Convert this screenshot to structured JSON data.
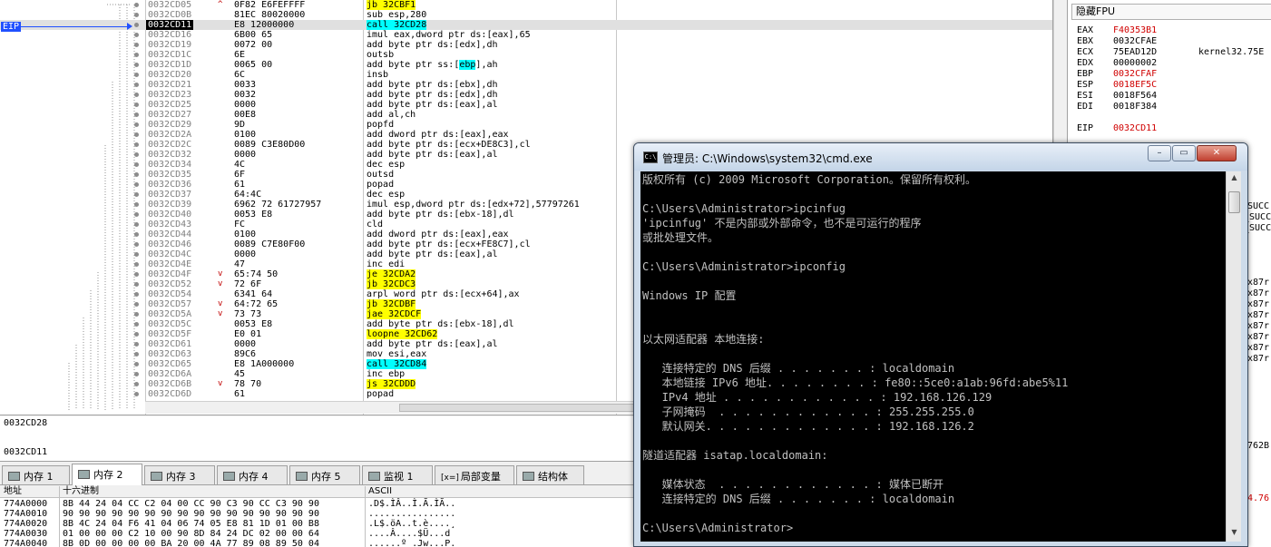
{
  "disasm": {
    "eip_label": "EIP",
    "rows": [
      {
        "addr": "0032CD05",
        "mark": "^",
        "hex": "0F82 E6FEFFFF",
        "asm": [
          {
            "t": "jb 32CBF1",
            "h": "y"
          }
        ]
      },
      {
        "addr": "0032CD0B",
        "mark": "",
        "hex": "81EC 80020000",
        "asm": [
          {
            "t": "sub esp,280"
          }
        ]
      },
      {
        "addr": "0032CD11",
        "mark": "",
        "hex": "E8 12000000",
        "asm": [
          {
            "t": "call 32CD28",
            "h": "c"
          }
        ],
        "current": true
      },
      {
        "addr": "0032CD16",
        "mark": "",
        "hex": "6B00 65",
        "asm": [
          {
            "t": "imul eax,dword ptr ds:[eax],65"
          }
        ]
      },
      {
        "addr": "0032CD19",
        "mark": "",
        "hex": "0072 00",
        "asm": [
          {
            "t": "add byte ptr ds:[edx],dh"
          }
        ]
      },
      {
        "addr": "0032CD1C",
        "mark": "",
        "hex": "6E",
        "asm": [
          {
            "t": "outsb"
          }
        ]
      },
      {
        "addr": "0032CD1D",
        "mark": "",
        "hex": "0065 00",
        "asm": [
          {
            "t": "add byte ptr ss:["
          },
          {
            "t": "ebp",
            "h": "c"
          },
          {
            "t": "],ah"
          }
        ]
      },
      {
        "addr": "0032CD20",
        "mark": "",
        "hex": "6C",
        "asm": [
          {
            "t": "insb"
          }
        ]
      },
      {
        "addr": "0032CD21",
        "mark": "",
        "hex": "0033",
        "asm": [
          {
            "t": "add byte ptr ds:[ebx],dh"
          }
        ]
      },
      {
        "addr": "0032CD23",
        "mark": "",
        "hex": "0032",
        "asm": [
          {
            "t": "add byte ptr ds:[edx],dh"
          }
        ]
      },
      {
        "addr": "0032CD25",
        "mark": "",
        "hex": "0000",
        "asm": [
          {
            "t": "add byte ptr ds:[eax],al"
          }
        ]
      },
      {
        "addr": "0032CD27",
        "mark": "",
        "hex": "00E8",
        "asm": [
          {
            "t": "add al,ch"
          }
        ]
      },
      {
        "addr": "0032CD29",
        "mark": "",
        "hex": "9D",
        "asm": [
          {
            "t": "popfd"
          }
        ]
      },
      {
        "addr": "0032CD2A",
        "mark": "",
        "hex": "0100",
        "asm": [
          {
            "t": "add dword ptr ds:[eax],eax"
          }
        ]
      },
      {
        "addr": "0032CD2C",
        "mark": "",
        "hex": "0089 C3E80D00",
        "asm": [
          {
            "t": "add byte ptr ds:[ecx+DE8C3],cl"
          }
        ]
      },
      {
        "addr": "0032CD32",
        "mark": "",
        "hex": "0000",
        "asm": [
          {
            "t": "add byte ptr ds:[eax],al"
          }
        ]
      },
      {
        "addr": "0032CD34",
        "mark": "",
        "hex": "4C",
        "asm": [
          {
            "t": "dec esp"
          }
        ]
      },
      {
        "addr": "0032CD35",
        "mark": "",
        "hex": "6F",
        "asm": [
          {
            "t": "outsd"
          }
        ]
      },
      {
        "addr": "0032CD36",
        "mark": "",
        "hex": "61",
        "asm": [
          {
            "t": "popad"
          }
        ]
      },
      {
        "addr": "0032CD37",
        "mark": "",
        "hex": "64:4C",
        "asm": [
          {
            "t": "dec esp"
          }
        ]
      },
      {
        "addr": "0032CD39",
        "mark": "",
        "hex": "6962 72 61727957",
        "asm": [
          {
            "t": "imul esp,dword ptr ds:[edx+72],57797261"
          }
        ]
      },
      {
        "addr": "0032CD40",
        "mark": "",
        "hex": "0053 E8",
        "asm": [
          {
            "t": "add byte ptr ds:[ebx-18],dl"
          }
        ]
      },
      {
        "addr": "0032CD43",
        "mark": "",
        "hex": "FC",
        "asm": [
          {
            "t": "cld"
          }
        ]
      },
      {
        "addr": "0032CD44",
        "mark": "",
        "hex": "0100",
        "asm": [
          {
            "t": "add dword ptr ds:[eax],eax"
          }
        ]
      },
      {
        "addr": "0032CD46",
        "mark": "",
        "hex": "0089 C7E80F00",
        "asm": [
          {
            "t": "add byte ptr ds:[ecx+FE8C7],cl"
          }
        ]
      },
      {
        "addr": "0032CD4C",
        "mark": "",
        "hex": "0000",
        "asm": [
          {
            "t": "add byte ptr ds:[eax],al"
          }
        ]
      },
      {
        "addr": "0032CD4E",
        "mark": "",
        "hex": "47",
        "asm": [
          {
            "t": "inc edi"
          }
        ]
      },
      {
        "addr": "0032CD4F",
        "mark": "v",
        "hex": "65:74 50",
        "asm": [
          {
            "t": "je 32CDA2",
            "h": "y"
          }
        ]
      },
      {
        "addr": "0032CD52",
        "mark": "v",
        "hex": "72 6F",
        "asm": [
          {
            "t": "jb 32CDC3",
            "h": "y"
          }
        ]
      },
      {
        "addr": "0032CD54",
        "mark": "",
        "hex": "6341 64",
        "asm": [
          {
            "t": "arpl word ptr ds:[ecx+64],ax"
          }
        ]
      },
      {
        "addr": "0032CD57",
        "mark": "v",
        "hex": "64:72 65",
        "asm": [
          {
            "t": "jb 32CDBF",
            "h": "y"
          }
        ]
      },
      {
        "addr": "0032CD5A",
        "mark": "v",
        "hex": "73 73",
        "asm": [
          {
            "t": "jae 32CDCF",
            "h": "y"
          }
        ]
      },
      {
        "addr": "0032CD5C",
        "mark": "",
        "hex": "0053 E8",
        "asm": [
          {
            "t": "add byte ptr ds:[ebx-18],dl"
          }
        ]
      },
      {
        "addr": "0032CD5F",
        "mark": "",
        "hex": "E0 01",
        "asm": [
          {
            "t": "loopne 32CD62",
            "h": "y"
          }
        ]
      },
      {
        "addr": "0032CD61",
        "mark": "",
        "hex": "0000",
        "asm": [
          {
            "t": "add byte ptr ds:[eax],al"
          }
        ]
      },
      {
        "addr": "0032CD63",
        "mark": "",
        "hex": "89C6",
        "asm": [
          {
            "t": "mov esi,eax"
          }
        ]
      },
      {
        "addr": "0032CD65",
        "mark": "",
        "hex": "E8 1A000000",
        "asm": [
          {
            "t": "call 32CD84",
            "h": "c"
          }
        ]
      },
      {
        "addr": "0032CD6A",
        "mark": "",
        "hex": "45",
        "asm": [
          {
            "t": "inc ebp"
          }
        ]
      },
      {
        "addr": "0032CD6B",
        "mark": "v",
        "hex": "78 70",
        "asm": [
          {
            "t": "js 32CDDD",
            "h": "y"
          }
        ]
      },
      {
        "addr": "0032CD6D",
        "mark": "",
        "hex": "61",
        "asm": [
          {
            "t": "popad"
          }
        ]
      }
    ]
  },
  "info": {
    "line1": "0032CD28",
    "line2": "0032CD11"
  },
  "tabs": [
    {
      "label": "内存 1",
      "active": false
    },
    {
      "label": "内存 2",
      "active": true
    },
    {
      "label": "内存 3",
      "active": false
    },
    {
      "label": "内存 4",
      "active": false
    },
    {
      "label": "内存 5",
      "active": false
    },
    {
      "label": "监视 1",
      "active": false
    },
    {
      "label": "局部变量",
      "prefix": "[x=]",
      "active": false
    },
    {
      "label": "结构体",
      "active": false
    }
  ],
  "dump": {
    "col_addr": "地址",
    "col_hex": "十六进制",
    "col_ascii": "ASCII",
    "rows": [
      {
        "addr": "774A0000",
        "hex": "8B 44 24 04 CC C2 04 00 CC 90 C3 90 CC C3 90 90",
        "ascii": ".D$.ÌÂ..Ì.Ã.ÌÃ.."
      },
      {
        "addr": "774A0010",
        "hex": "90 90 90 90 90 90 90 90 90 90 90 90 90 90 90 90",
        "ascii": "................"
      },
      {
        "addr": "774A0020",
        "hex": "8B 4C 24 04 F6 41 04 06 74 05 E8 81 1D 01 00 B8",
        "ascii": ".L$.öA..t.è....¸"
      },
      {
        "addr": "774A0030",
        "hex": "01 00 00 00 C2 10 00 90 8D 84 24 DC 02 00 00 64",
        "ascii": "....Â....$Ü...d"
      },
      {
        "addr": "774A0040",
        "hex": "8B 0D 00 00 00 00 BA 20 00 4A 77 89 08 89 50 04",
        "ascii": "......º .Jw...P."
      }
    ]
  },
  "registers": {
    "title": "隐藏FPU",
    "items": [
      {
        "name": "EAX",
        "value": "F40353B1",
        "red": true,
        "extra": ""
      },
      {
        "name": "EBX",
        "value": "0032CFAE",
        "red": false,
        "extra": ""
      },
      {
        "name": "ECX",
        "value": "75EAD12D",
        "red": false,
        "extra": "kernel32.75E"
      },
      {
        "name": "EDX",
        "value": "00000002",
        "red": false,
        "extra": ""
      },
      {
        "name": "EBP",
        "value": "0032CFAF",
        "red": true,
        "extra": ""
      },
      {
        "name": "ESP",
        "value": "0018EF5C",
        "red": true,
        "extra": ""
      },
      {
        "name": "ESI",
        "value": "0018F564",
        "red": false,
        "extra": ""
      },
      {
        "name": "EDI",
        "value": "0018F384",
        "red": false,
        "extra": ""
      }
    ],
    "eip": {
      "name": "EIP",
      "value": "0032CD11"
    },
    "side_fragments": [
      "SUCC",
      "_SUCC",
      "_SUCC",
      "x87r",
      "x87r",
      "x87r",
      "x87r",
      "x87r",
      "x87r",
      "x87r",
      "x87r",
      "762B",
      "4.76"
    ]
  },
  "cmd": {
    "title": "管理员: C:\\Windows\\system32\\cmd.exe",
    "icon_text": "C:\\",
    "buttons": {
      "minimize": "–",
      "restore": "▭",
      "close": "✕"
    },
    "lines": [
      "版权所有 (c) 2009 Microsoft Corporation。保留所有权利。",
      "",
      "C:\\Users\\Administrator>ipcinfug",
      "'ipcinfug' 不是内部或外部命令，也不是可运行的程序",
      "或批处理文件。",
      "",
      "C:\\Users\\Administrator>ipconfig",
      "",
      "Windows IP 配置",
      "",
      "",
      "以太网适配器 本地连接:",
      "",
      "   连接特定的 DNS 后缀 . . . . . . . : localdomain",
      "   本地链接 IPv6 地址. . . . . . . . : fe80::5ce0:a1ab:96fd:abe5%11",
      "   IPv4 地址 . . . . . . . . . . . . : 192.168.126.129",
      "   子网掩码  . . . . . . . . . . . . : 255.255.255.0",
      "   默认网关. . . . . . . . . . . . . : 192.168.126.2",
      "",
      "隧道适配器 isatap.localdomain:",
      "",
      "   媒体状态  . . . . . . . . . . . . : 媒体已断开",
      "   连接特定的 DNS 后缀 . . . . . . . : localdomain",
      "",
      "C:\\Users\\Administrator>"
    ]
  },
  "colors": {
    "yellow_hl": "#ffff00",
    "cyan_hl": "#00ffff",
    "eip_blue": "#2050ff",
    "reg_red": "#d00000"
  }
}
